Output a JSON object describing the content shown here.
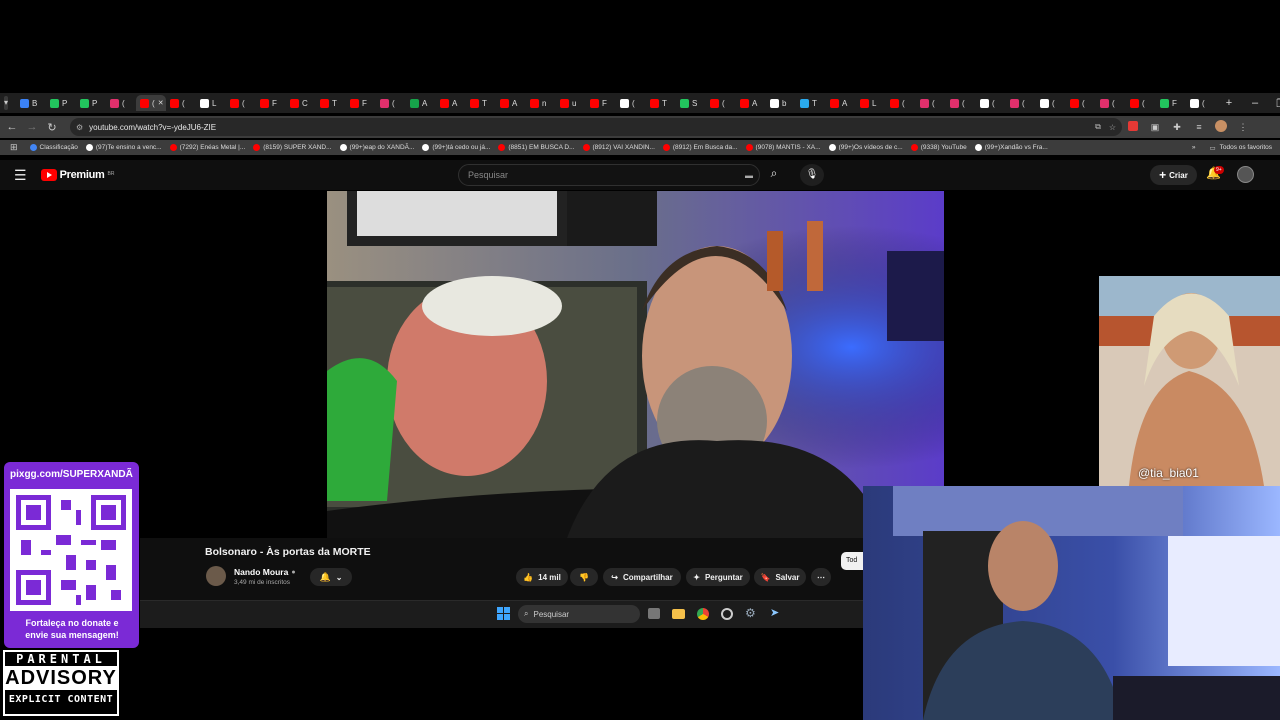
{
  "browser": {
    "tabs_visible": [
      {
        "letter": "B",
        "color": "#3b82f6"
      },
      {
        "letter": "P",
        "color": "#22c55e"
      },
      {
        "letter": "P",
        "color": "#22c55e"
      },
      {
        "letter": "(",
        "color": "#e1306c"
      },
      {
        "letter": "(",
        "color": "#ff0000",
        "active": true
      },
      {
        "letter": "(",
        "color": "#ff0000"
      },
      {
        "letter": "L",
        "color": "#ffffff"
      },
      {
        "letter": "(",
        "color": "#ff0000"
      },
      {
        "letter": "F",
        "color": "#ff0000"
      },
      {
        "letter": "C",
        "color": "#ff0000"
      },
      {
        "letter": "T",
        "color": "#ff0000"
      },
      {
        "letter": "F",
        "color": "#ff0000"
      },
      {
        "letter": "(",
        "color": "#e1306c"
      },
      {
        "letter": "A",
        "color": "#16a34a"
      },
      {
        "letter": "A",
        "color": "#ff0000"
      },
      {
        "letter": "T",
        "color": "#ff0000"
      },
      {
        "letter": "A",
        "color": "#ff0000"
      },
      {
        "letter": "n",
        "color": "#ff0000"
      },
      {
        "letter": "u",
        "color": "#ff0000"
      },
      {
        "letter": "F",
        "color": "#ff0000"
      },
      {
        "letter": "(",
        "color": "#ffffff"
      },
      {
        "letter": "T",
        "color": "#ff0000"
      },
      {
        "letter": "S",
        "color": "#22c55e"
      },
      {
        "letter": "(",
        "color": "#ff0000"
      },
      {
        "letter": "A",
        "color": "#ff0000"
      },
      {
        "letter": "b",
        "color": "#ffffff"
      },
      {
        "letter": "T",
        "color": "#2aabee"
      },
      {
        "letter": "A",
        "color": "#ff0000"
      },
      {
        "letter": "L",
        "color": "#ff0000"
      },
      {
        "letter": "(",
        "color": "#ff0000"
      },
      {
        "letter": "(",
        "color": "#e1306c"
      },
      {
        "letter": "(",
        "color": "#e1306c"
      },
      {
        "letter": "(",
        "color": "#ffffff"
      },
      {
        "letter": "(",
        "color": "#e1306c"
      },
      {
        "letter": "(",
        "color": "#ffffff"
      },
      {
        "letter": "(",
        "color": "#ff0000"
      },
      {
        "letter": "(",
        "color": "#e1306c"
      },
      {
        "letter": "(",
        "color": "#ff0000"
      },
      {
        "letter": "F",
        "color": "#22c55e"
      },
      {
        "letter": "(",
        "color": "#ffffff"
      }
    ],
    "new_tab_icon": "+",
    "url": "youtube.com/watch?v=-ydeJU6-ZIE",
    "bookmarks": [
      {
        "label": "Classificação",
        "color": "#4285f4"
      },
      {
        "label": "(97)Te ensino a venc...",
        "color": "#ffffff"
      },
      {
        "label": "(7292) Enéas Metal |...",
        "color": "#ff0000"
      },
      {
        "label": "(8159) SUPER XAND...",
        "color": "#ff0000"
      },
      {
        "label": "(99+)eap do XANDÃ...",
        "color": "#ffffff"
      },
      {
        "label": "(99+)tá cedo ou já...",
        "color": "#ffffff"
      },
      {
        "label": "(8851) EM BUSCA D...",
        "color": "#ff0000"
      },
      {
        "label": "(8912) VAI XANDIN...",
        "color": "#ff0000"
      },
      {
        "label": "(8912) Em Busca da...",
        "color": "#ff0000"
      },
      {
        "label": "(9078) MANTIS - XA...",
        "color": "#ff0000"
      },
      {
        "label": "(99+)Os vídeos de c...",
        "color": "#ffffff"
      },
      {
        "label": "(9338) YouTube",
        "color": "#ff0000"
      },
      {
        "label": "(99+)Xandão vs Fra...",
        "color": "#ffffff"
      }
    ],
    "all_bookmarks": "Todos os favoritos"
  },
  "youtube": {
    "logo": "Premium",
    "region": "BR",
    "search_placeholder": "Pesquisar",
    "create_label": "Criar",
    "notif_count": "9+",
    "video_title": "Bolsonaro - Às portas da MORTE",
    "channel_name": "Nando Moura",
    "subscribers": "3,49 mi de inscritos",
    "likes": "14 mil",
    "share_label": "Compartilhar",
    "ask_label": "Perguntar",
    "save_label": "Salvar",
    "chip_label": "Tod"
  },
  "taskbar": {
    "search_label": "Pesquisar"
  },
  "overlay": {
    "pix_url": "pixgg.com/SUPERXANDÃ",
    "donate_text": "Fortaleça no donate e envie sua mensagem!",
    "advisory_line1": "PARENTAL",
    "advisory_line2": "ADVISORY",
    "advisory_line3": "EXPLICIT CONTENT",
    "photo_watermark": "@tia_bia01"
  },
  "colors": {
    "youtube_red": "#ff0000",
    "pix_purple": "#7b2ad6",
    "tab_bg": "#1f1f1f",
    "toolbar_bg": "#3c3c3c"
  }
}
